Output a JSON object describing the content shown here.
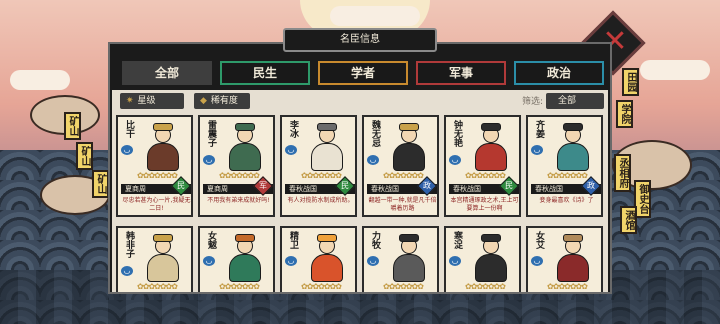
{
  "dialog": {
    "title": "名臣信息"
  },
  "tabs": [
    {
      "label": "全部",
      "border": "#3e3e3e"
    },
    {
      "label": "民生",
      "border": "#2e9a6a"
    },
    {
      "label": "学者",
      "border": "#c88a2e"
    },
    {
      "label": "军事",
      "border": "#b03a3a"
    },
    {
      "label": "政治",
      "border": "#2b8ea8"
    }
  ],
  "filters": {
    "star_label": "星级",
    "rarity_label": "稀有度",
    "filter_prefix": "筛选:",
    "filter_value": "全部",
    "more_icon": "more-dots-icon"
  },
  "map_signs": {
    "left": [
      "矿山",
      "矿山",
      "矿山"
    ],
    "right": [
      "田园",
      "学院",
      "丞相府",
      "御史台",
      "酒馆"
    ]
  },
  "ministers": [
    {
      "name": "比干",
      "era": "夏商周",
      "type": "民",
      "type_color": "#2e8a3e",
      "quote": "尽忠若甚为心一片,我疑无二日!",
      "robe": "#6b3b2a",
      "hat": "#c9a24a"
    },
    {
      "name": "雷震子",
      "era": "夏商周",
      "type": "军",
      "type_color": "#b03a3a",
      "quote": "不用我有弟来成就好吗!",
      "robe": "#3f6b50",
      "hat": "#3f6b50"
    },
    {
      "name": "李冰",
      "era": "春秋战国",
      "type": "民",
      "type_color": "#2e8a3e",
      "quote": "有人对揽防水制成所助。",
      "robe": "#e9e2d2",
      "hat": "#6b6b6b"
    },
    {
      "name": "魏无忌",
      "era": "春秋战国",
      "type": "政",
      "type_color": "#2e5fa8",
      "quote": "翻越一带一种,就是凡千倍嚼着历路",
      "robe": "#2c2c2c",
      "hat": "#c9a24a"
    },
    {
      "name": "钟无艳",
      "era": "春秋战国",
      "type": "民",
      "type_color": "#2e8a3e",
      "quote": "本宫精通琢政之术,王上可要算上一份啊",
      "robe": "#b5382f",
      "hat": "#2c2c2c"
    },
    {
      "name": "齐姜",
      "era": "春秋战国",
      "type": "政",
      "type_color": "#2e5fa8",
      "quote": "妾身最喜欢《诗》了",
      "robe": "#3d8a8a",
      "hat": "#2c2c2c"
    },
    {
      "name": "韩非子",
      "era": "",
      "type": "",
      "type_color": "#2e5fa8",
      "quote": "",
      "robe": "#d8c69b",
      "hat": "#c9a24a"
    },
    {
      "name": "女魃",
      "era": "",
      "type": "",
      "type_color": "#2e5fa8",
      "quote": "",
      "robe": "#2f7a5a",
      "hat": "#c46a2a"
    },
    {
      "name": "精卫",
      "era": "",
      "type": "",
      "type_color": "#2e5fa8",
      "quote": "",
      "robe": "#d9532b",
      "hat": "#f0a13a"
    },
    {
      "name": "力牧",
      "era": "",
      "type": "",
      "type_color": "#2e5fa8",
      "quote": "",
      "robe": "#5a5a5a",
      "hat": "#2c2c2c"
    },
    {
      "name": "寒浞",
      "era": "",
      "type": "",
      "type_color": "#2e5fa8",
      "quote": "",
      "robe": "#2c2c2c",
      "hat": "#2c2c2c"
    },
    {
      "name": "女艾",
      "era": "",
      "type": "",
      "type_color": "#2e5fa8",
      "quote": "",
      "robe": "#8a2a2a",
      "hat": "#b08a5a"
    }
  ]
}
